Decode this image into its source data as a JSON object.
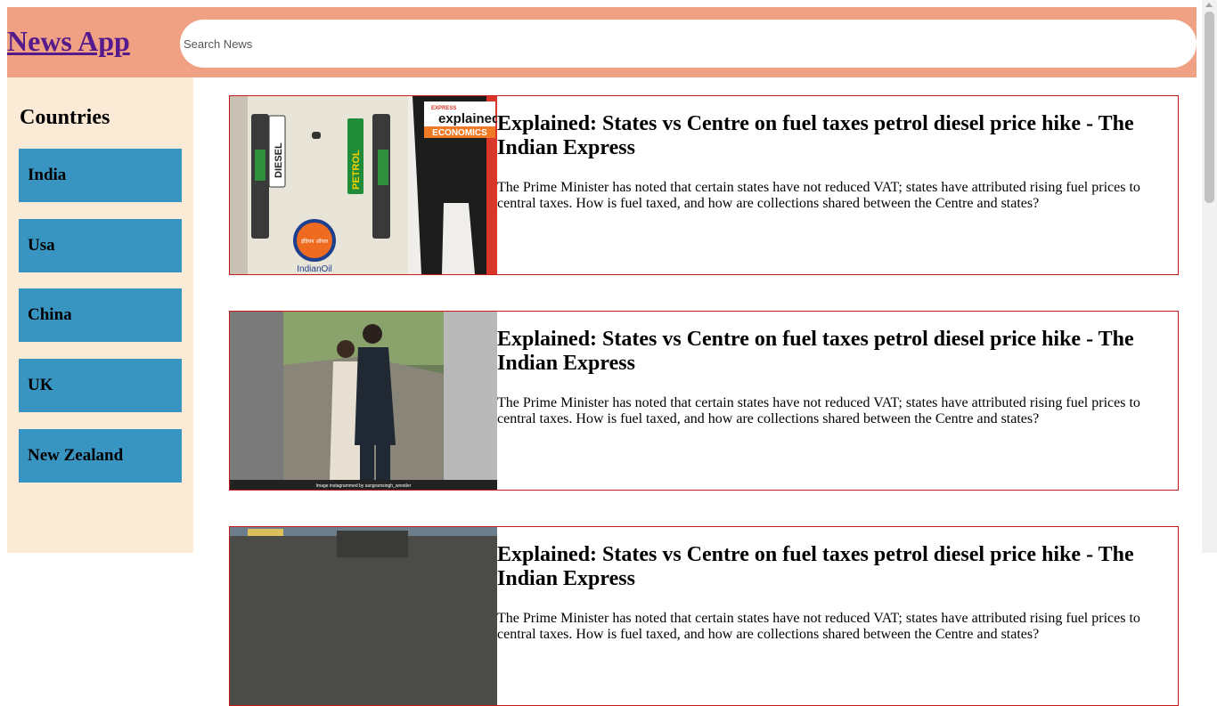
{
  "header": {
    "app_title": "News App",
    "search_placeholder": "Search News",
    "search_value": ""
  },
  "sidebar": {
    "title": "Countries",
    "countries": [
      "India",
      "Usa",
      "China",
      "UK",
      "New Zealand"
    ]
  },
  "articles": [
    {
      "title": "Explained: States vs Centre on fuel taxes petrol diesel price hike - The Indian Express",
      "description": "The Prime Minister has noted that certain states have not reduced VAT; states have attributed rising fuel prices to central taxes. How is fuel taxed, and how are collections shared between the Centre and states?",
      "image_text": {
        "brand_top": "EXPRESS",
        "brand": "explained.",
        "section": "ECONOMICS",
        "pump_left": "DIESEL",
        "pump_right": "PETROL",
        "logo_hindi": "इंडियन ऑयल",
        "logo": "IndianOil"
      }
    },
    {
      "title": "Explained: States vs Centre on fuel taxes petrol diesel price hike - The Indian Express",
      "description": "The Prime Minister has noted that certain states have not reduced VAT; states have attributed rising fuel prices to central taxes. How is fuel taxed, and how are collections shared between the Centre and states?",
      "image_text": {
        "caption": "Image instagrammed by sangramsingh_wrestler"
      }
    },
    {
      "title": "Explained: States vs Centre on fuel taxes petrol diesel price hike - The Indian Express",
      "description": "The Prime Minister has noted that certain states have not reduced VAT; states have attributed rising fuel prices to central taxes. How is fuel taxed, and how are collections shared between the Centre and states?"
    }
  ],
  "colors": {
    "header_bg": "#f0a184",
    "sidebar_bg": "#faead6",
    "country_button_bg": "#3895c1",
    "card_border": "#c41a1a",
    "title_link": "#551a8b"
  }
}
